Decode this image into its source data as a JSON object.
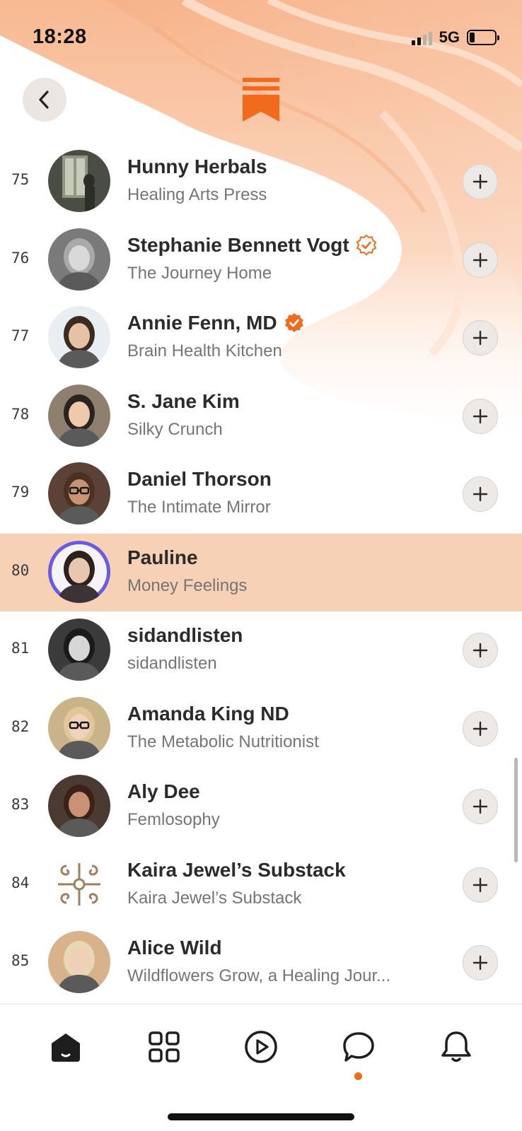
{
  "status_bar": {
    "time": "18:28",
    "network": "5G",
    "battery_level": 0.2
  },
  "colors": {
    "accent": "#f26a1b",
    "highlight": "#f4c4a0",
    "wave": "#f7b891"
  },
  "header": {
    "back_icon": "chevron-left-icon",
    "logo_icon": "substack-logo-icon"
  },
  "list": {
    "items": [
      {
        "rank": "75",
        "name": "Hunny Herbals",
        "publication": "Healing Arts Press",
        "verified": "none",
        "highlighted": false
      },
      {
        "rank": "76",
        "name": "Stephanie Bennett Vogt",
        "publication": "The Journey Home",
        "verified": "outline",
        "highlighted": false
      },
      {
        "rank": "77",
        "name": "Annie Fenn, MD",
        "publication": "Brain Health Kitchen",
        "verified": "filled",
        "highlighted": false
      },
      {
        "rank": "78",
        "name": "S. Jane Kim",
        "publication": "Silky Crunch",
        "verified": "none",
        "highlighted": false
      },
      {
        "rank": "79",
        "name": "Daniel Thorson",
        "publication": "The Intimate Mirror",
        "verified": "none",
        "highlighted": false
      },
      {
        "rank": "80",
        "name": "Pauline",
        "publication": "Money Feelings",
        "verified": "none",
        "highlighted": true
      },
      {
        "rank": "81",
        "name": "sidandlisten",
        "publication": "sidandlisten",
        "verified": "none",
        "highlighted": false
      },
      {
        "rank": "82",
        "name": "Amanda King ND",
        "publication": "The Metabolic Nutritionist",
        "verified": "none",
        "highlighted": false
      },
      {
        "rank": "83",
        "name": "Aly Dee",
        "publication": "Femlosophy",
        "verified": "none",
        "highlighted": false
      },
      {
        "rank": "84",
        "name": "Kaira Jewel’s Substack",
        "publication": "Kaira Jewel’s Substack",
        "verified": "none",
        "highlighted": false
      },
      {
        "rank": "85",
        "name": "Alice Wild",
        "publication": "Wildflowers Grow, a Healing Jour...",
        "verified": "none",
        "highlighted": false
      }
    ]
  },
  "tab_bar": {
    "tabs": [
      {
        "icon": "home-icon",
        "active": true
      },
      {
        "icon": "grid-icon",
        "active": false
      },
      {
        "icon": "play-icon",
        "active": false
      },
      {
        "icon": "chat-icon",
        "active": false,
        "has_notification_dot": true
      },
      {
        "icon": "bell-icon",
        "active": false
      }
    ]
  }
}
